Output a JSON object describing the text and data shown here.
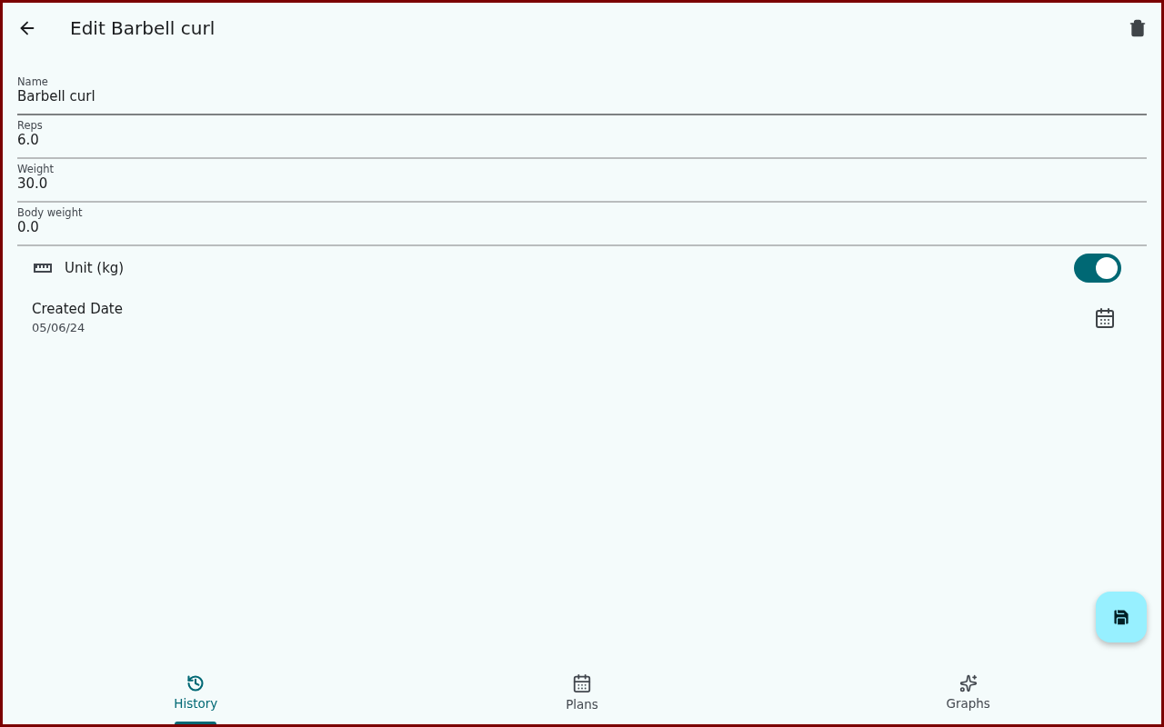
{
  "app_bar": {
    "title": "Edit Barbell curl"
  },
  "fields": [
    {
      "label": "Name",
      "value": "Barbell curl",
      "focused": true
    },
    {
      "label": "Reps",
      "value": "6.0",
      "focused": false
    },
    {
      "label": "Weight",
      "value": "30.0",
      "focused": false
    },
    {
      "label": "Body weight",
      "value": "0.0",
      "focused": false
    }
  ],
  "unit": {
    "label": "Unit (kg)",
    "on": true
  },
  "created_date": {
    "label": "Created Date",
    "value": "05/06/24"
  },
  "nav": [
    {
      "label": "History",
      "kind": "history",
      "selected": true
    },
    {
      "label": "Plans",
      "kind": "plans",
      "selected": false
    },
    {
      "label": "Graphs",
      "kind": "graphs",
      "selected": false
    }
  ]
}
